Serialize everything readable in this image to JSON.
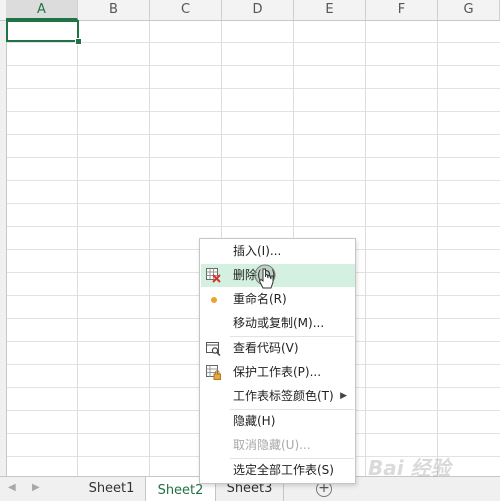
{
  "columns": [
    {
      "label": "A",
      "active": true
    },
    {
      "label": "B"
    },
    {
      "label": "C"
    },
    {
      "label": "D"
    },
    {
      "label": "E"
    },
    {
      "label": "F"
    },
    {
      "label": "G"
    }
  ],
  "sheet_tabs": [
    {
      "label": "Sheet1",
      "active": false
    },
    {
      "label": "Sheet2",
      "active": true
    },
    {
      "label": "Sheet3",
      "active": false
    }
  ],
  "add_sheet_glyph": "+",
  "context_menu": {
    "items": [
      {
        "label": "插入(I)...",
        "icon": "none"
      },
      {
        "label": "删除(D)",
        "icon": "delete-sheet-icon",
        "hover": true
      },
      {
        "label": "重命名(R)",
        "icon": "bullet-dot"
      },
      {
        "label": "移动或复制(M)...",
        "icon": "none"
      },
      {
        "label": "查看代码(V)",
        "icon": "view-code-icon"
      },
      {
        "label": "保护工作表(P)...",
        "icon": "protect-sheet-icon"
      },
      {
        "label": "工作表标签颜色(T)",
        "icon": "none",
        "submenu": true
      },
      {
        "label": "隐藏(H)",
        "icon": "none"
      },
      {
        "label": "取消隐藏(U)...",
        "icon": "none",
        "disabled": true
      },
      {
        "label": "选定全部工作表(S)",
        "icon": "none"
      }
    ]
  },
  "watermark_text": "Bai 经验",
  "colors": {
    "accent": "#217346",
    "hover_bg": "#d3f0e0",
    "bullet": "#f0a030",
    "delete_red": "#d9342b",
    "disabled": "#a8a8a8"
  }
}
